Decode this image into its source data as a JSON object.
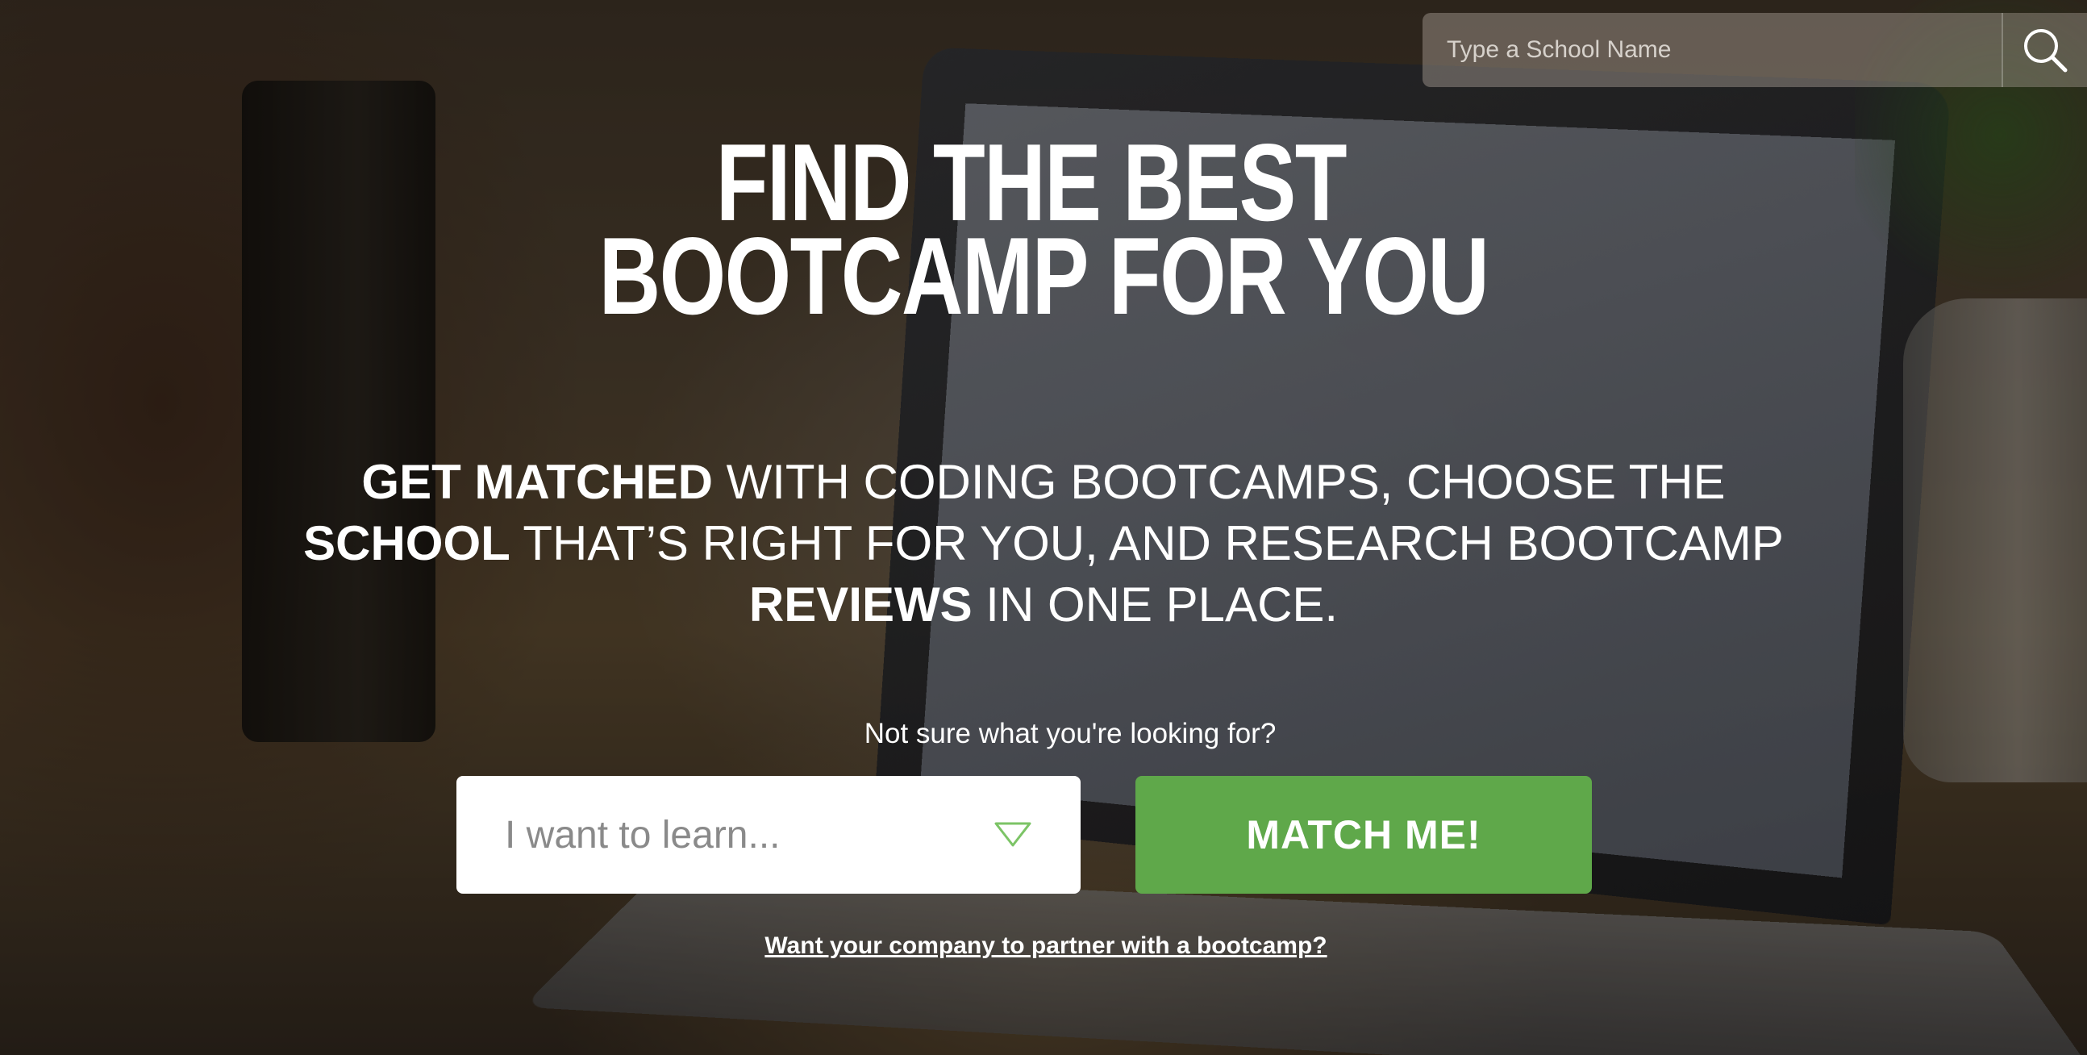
{
  "top_search": {
    "placeholder": "Type a School Name",
    "icon": "search-icon"
  },
  "hero": {
    "headline_line1": "FIND THE BEST",
    "headline_line2": "BOOTCAMP FOR YOU",
    "tagline": {
      "part1_bold": "GET MATCHED",
      "part2": " WITH CODING BOOTCAMPS, CHOOSE THE ",
      "part3_bold": "SCHOOL",
      "part4": " THAT’S RIGHT FOR YOU, AND RESEARCH BOOTCAMP ",
      "part5_bold": "REVIEWS",
      "part6": " IN ONE PLACE."
    }
  },
  "match_form": {
    "prompt": "Not sure what you're looking for?",
    "select_placeholder": "I want to learn...",
    "button_label": "MATCH ME!",
    "partner_link": "Want your company to partner with a bootcamp?"
  },
  "colors": {
    "accent_green": "#5fa84a",
    "select_arrow": "#7cc466"
  }
}
